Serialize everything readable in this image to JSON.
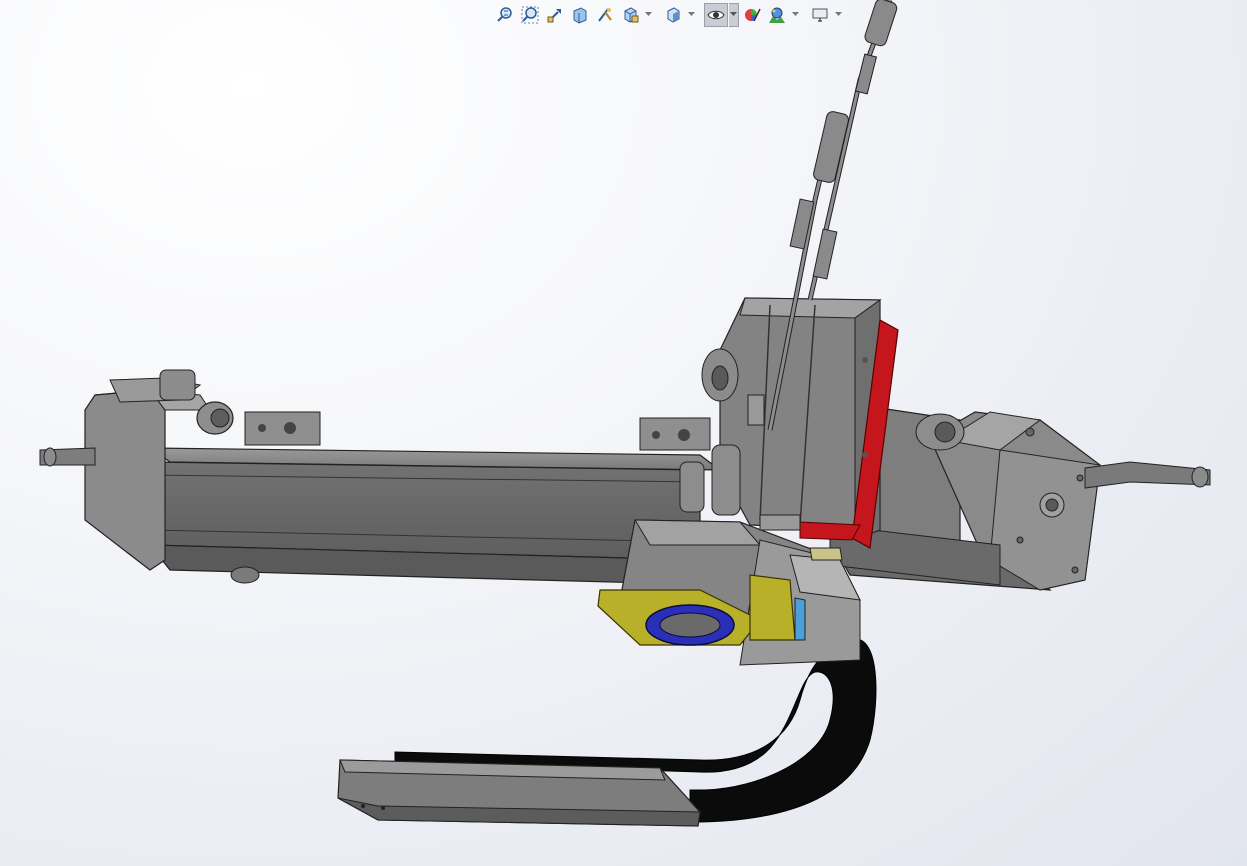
{
  "toolbar": {
    "items": [
      {
        "icon": "zoom-to-fit-icon"
      },
      {
        "icon": "zoom-to-area-icon"
      },
      {
        "icon": "previous-view-icon"
      },
      {
        "icon": "section-view-icon"
      },
      {
        "icon": "dynamic-annotation-views-icon"
      },
      {
        "icon": "view-orientation-icon",
        "dropdown": true
      },
      {
        "icon": "display-style-icon",
        "dropdown": true
      },
      {
        "icon": "hide-show-items-icon",
        "dropdown": true,
        "active": true
      },
      {
        "icon": "edit-appearance-icon"
      },
      {
        "icon": "apply-scene-icon",
        "dropdown": true
      },
      {
        "icon": "view-settings-icon",
        "dropdown": true
      }
    ]
  },
  "colors": {
    "part_gray": "#8c8c8c",
    "part_dark": "#4a4a4a",
    "red_plate": "#c4161c",
    "yellow_plate": "#b9b02a",
    "blue_ring": "#2a2fb8",
    "cable_chain": "#0a0a0a"
  }
}
